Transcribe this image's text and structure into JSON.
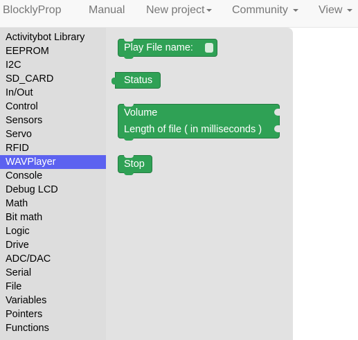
{
  "navbar": {
    "brand": "BlocklyProp",
    "manual": "Manual",
    "new_project": "New project",
    "community": "Community",
    "view": "View"
  },
  "toolbox": {
    "items": [
      {
        "label": "Activitybot Library"
      },
      {
        "label": "EEPROM"
      },
      {
        "label": "I2C"
      },
      {
        "label": "SD_CARD"
      },
      {
        "label": "In/Out"
      },
      {
        "label": "Control"
      },
      {
        "label": "Sensors"
      },
      {
        "label": "Servo"
      },
      {
        "label": "RFID"
      },
      {
        "label": "WAVPlayer"
      },
      {
        "label": "Console"
      },
      {
        "label": "Debug LCD"
      },
      {
        "label": "Math"
      },
      {
        "label": "Bit math"
      },
      {
        "label": "Logic"
      },
      {
        "label": "Drive"
      },
      {
        "label": "ADC/DAC"
      },
      {
        "label": "Serial"
      },
      {
        "label": "File"
      },
      {
        "label": "Variables"
      },
      {
        "label": "Pointers"
      },
      {
        "label": "Functions"
      }
    ],
    "selected": "WAVPlayer",
    "selected_color": "#5c62f0"
  },
  "blocks": {
    "color": "#2fa155",
    "play": {
      "label": "Play  File name:"
    },
    "status": {
      "label": "Status"
    },
    "volume": {
      "label": "Volume"
    },
    "length": {
      "label": "Length of file ( in milliseconds )"
    },
    "stop": {
      "label": "Stop"
    }
  }
}
